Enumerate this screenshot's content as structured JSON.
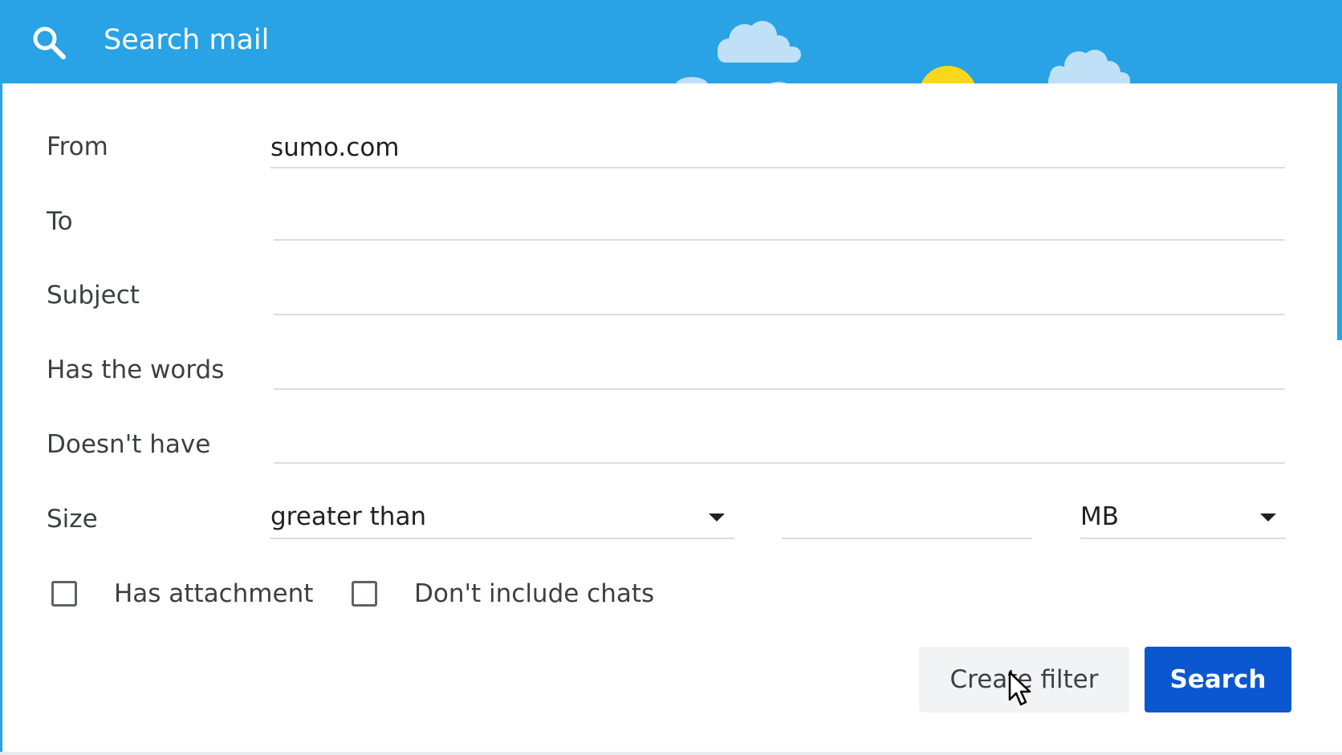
{
  "header": {
    "search_placeholder": "Search mail",
    "background_color": "#29a2e6"
  },
  "form": {
    "from": {
      "label": "From",
      "value": "sumo.com"
    },
    "to": {
      "label": "To",
      "value": ""
    },
    "subject": {
      "label": "Subject",
      "value": ""
    },
    "has_words": {
      "label": "Has the words",
      "value": ""
    },
    "doesnt_have": {
      "label": "Doesn't have",
      "value": ""
    },
    "size": {
      "label": "Size",
      "comparator": "greater than",
      "amount": "",
      "unit": "MB"
    },
    "has_attachment": {
      "label": "Has attachment",
      "checked": false
    },
    "dont_include_chats": {
      "label": "Don't include chats",
      "checked": false
    }
  },
  "actions": {
    "create_filter_label": "Create filter",
    "search_label": "Search",
    "search_color": "#0b57d0"
  },
  "icons": [
    "search-icon",
    "cloud-icon",
    "sun-icon",
    "chevron-down-icon",
    "mouse-cursor-icon"
  ]
}
